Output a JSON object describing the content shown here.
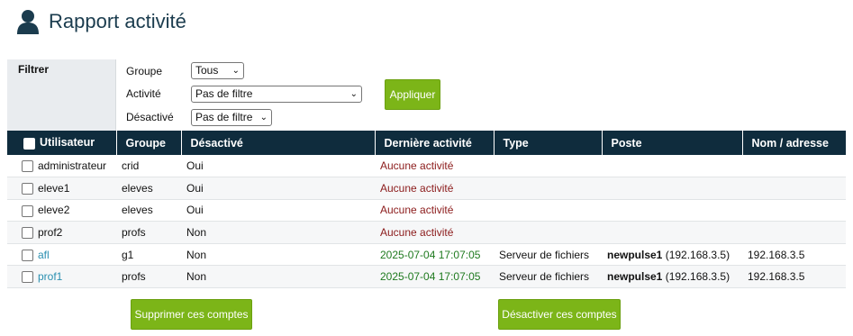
{
  "page": {
    "title": "Rapport activité"
  },
  "filter": {
    "label": "Filtrer",
    "groupe_label": "Groupe",
    "groupe_value": "Tous",
    "activite_label": "Activité",
    "activite_value": "Pas de filtre",
    "desactive_label": "Désactivé",
    "desactive_value": "Pas de filtre",
    "apply_label": "Appliquer"
  },
  "table": {
    "headers": [
      "Utilisateur",
      "Groupe",
      "Désactivé",
      "Dernière activité",
      "Type",
      "Poste",
      "Nom / adresse"
    ],
    "rows": [
      {
        "user": "administrateur",
        "group": "crid",
        "disabled": "Oui",
        "activity": "Aucune activité",
        "type": "",
        "host": "",
        "ip": "",
        "address": ""
      },
      {
        "user": "eleve1",
        "group": "eleves",
        "disabled": "Oui",
        "activity": "Aucune activité",
        "type": "",
        "host": "",
        "ip": "",
        "address": ""
      },
      {
        "user": "eleve2",
        "group": "eleves",
        "disabled": "Oui",
        "activity": "Aucune activité",
        "type": "",
        "host": "",
        "ip": "",
        "address": ""
      },
      {
        "user": "prof2",
        "group": "profs",
        "disabled": "Non",
        "activity": "Aucune activité",
        "type": "",
        "host": "",
        "ip": "",
        "address": ""
      },
      {
        "user": "afl",
        "group": "g1",
        "disabled": "Non",
        "activity": "2025-07-04 17:07:05",
        "type": "Serveur de fichiers",
        "host": "newpulse1",
        "ip": "(192.168.3.5)",
        "address": "192.168.3.5"
      },
      {
        "user": "prof1",
        "group": "profs",
        "disabled": "Non",
        "activity": "2025-07-04 17:07:05",
        "type": "Serveur de fichiers",
        "host": "newpulse1",
        "ip": "(192.168.3.5)",
        "address": "192.168.3.5"
      }
    ]
  },
  "actions": {
    "delete_label": "Supprimer ces comptes",
    "disable_label": "Désactiver ces comptes"
  }
}
